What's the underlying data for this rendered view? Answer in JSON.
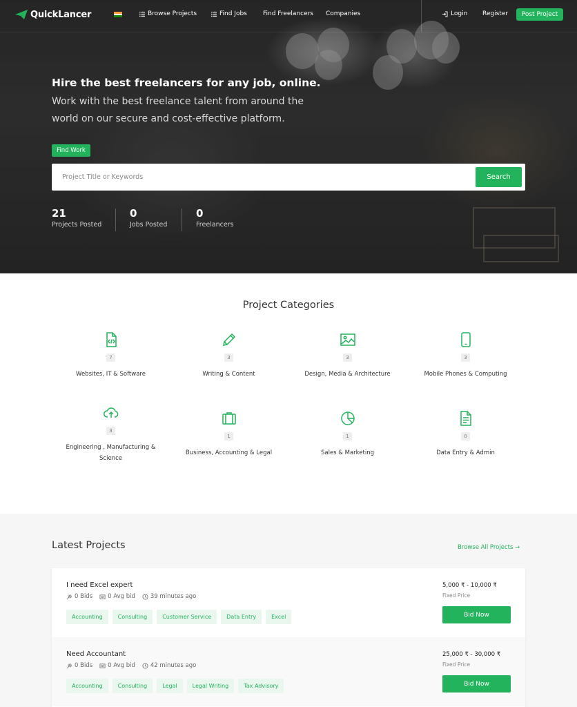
{
  "brand": {
    "name": "QuickLancer",
    "accent": "#22b35c"
  },
  "nav": {
    "browse_projects": "Browse Projects",
    "find_jobs": "Find Jobs",
    "find_freelancers": "Find Freelancers",
    "companies": "Companies",
    "login": "Login",
    "register": "Register",
    "post_project": "Post Project"
  },
  "hero": {
    "title": "Hire the best freelancers for any job, online.",
    "subtitle": "Work with the best freelance talent from around the world on our secure and cost-effective platform.",
    "find_work": "Find Work",
    "search_placeholder": "Project Title or Keywords",
    "search_button": "Search",
    "stats": [
      {
        "value": "21",
        "label": "Projects Posted"
      },
      {
        "value": "0",
        "label": "Jobs Posted"
      },
      {
        "value": "0",
        "label": "Freelancers"
      }
    ]
  },
  "categories": {
    "title": "Project Categories",
    "items": [
      {
        "icon": "code-file-icon",
        "count": "7",
        "name": "Websites, IT & Software"
      },
      {
        "icon": "pencil-icon",
        "count": "3",
        "name": "Writing & Content"
      },
      {
        "icon": "image-icon",
        "count": "3",
        "name": "Design, Media & Architecture"
      },
      {
        "icon": "mobile-phone-icon",
        "count": "3",
        "name": "Mobile Phones & Computing"
      },
      {
        "icon": "cloud-upload-icon",
        "count": "3",
        "name": "Engineering , Manufacturing & Science"
      },
      {
        "icon": "briefcase-icon",
        "count": "1",
        "name": "Business, Accounting & Legal"
      },
      {
        "icon": "pie-chart-icon",
        "count": "1",
        "name": "Sales & Marketing"
      },
      {
        "icon": "document-icon",
        "count": "0",
        "name": "Data Entry & Admin"
      }
    ]
  },
  "latest": {
    "title": "Latest Projects",
    "browse_all": "Browse All Projects →",
    "projects": [
      {
        "title": "I need Excel expert",
        "bids": "0 Bids",
        "avg_bid": "0 Avg bid",
        "time": "39 minutes ago",
        "tags": [
          "Accounting",
          "Consulting",
          "Customer Service",
          "Data Entry",
          "Excel"
        ],
        "price": "5,000 ₹ - 10,000 ₹",
        "price_type": "Fixed Price",
        "bid_button": "Bid Now"
      },
      {
        "title": "Need Accountant",
        "bids": "0 Bids",
        "avg_bid": "0 Avg bid",
        "time": "42 minutes ago",
        "tags": [
          "Accounting",
          "Consulting",
          "Legal",
          "Legal Writing",
          "Tax Advisory"
        ],
        "price": "25,000 ₹ - 30,000 ₹",
        "price_type": "Fixed Price",
        "bid_button": "Bid Now"
      }
    ]
  }
}
